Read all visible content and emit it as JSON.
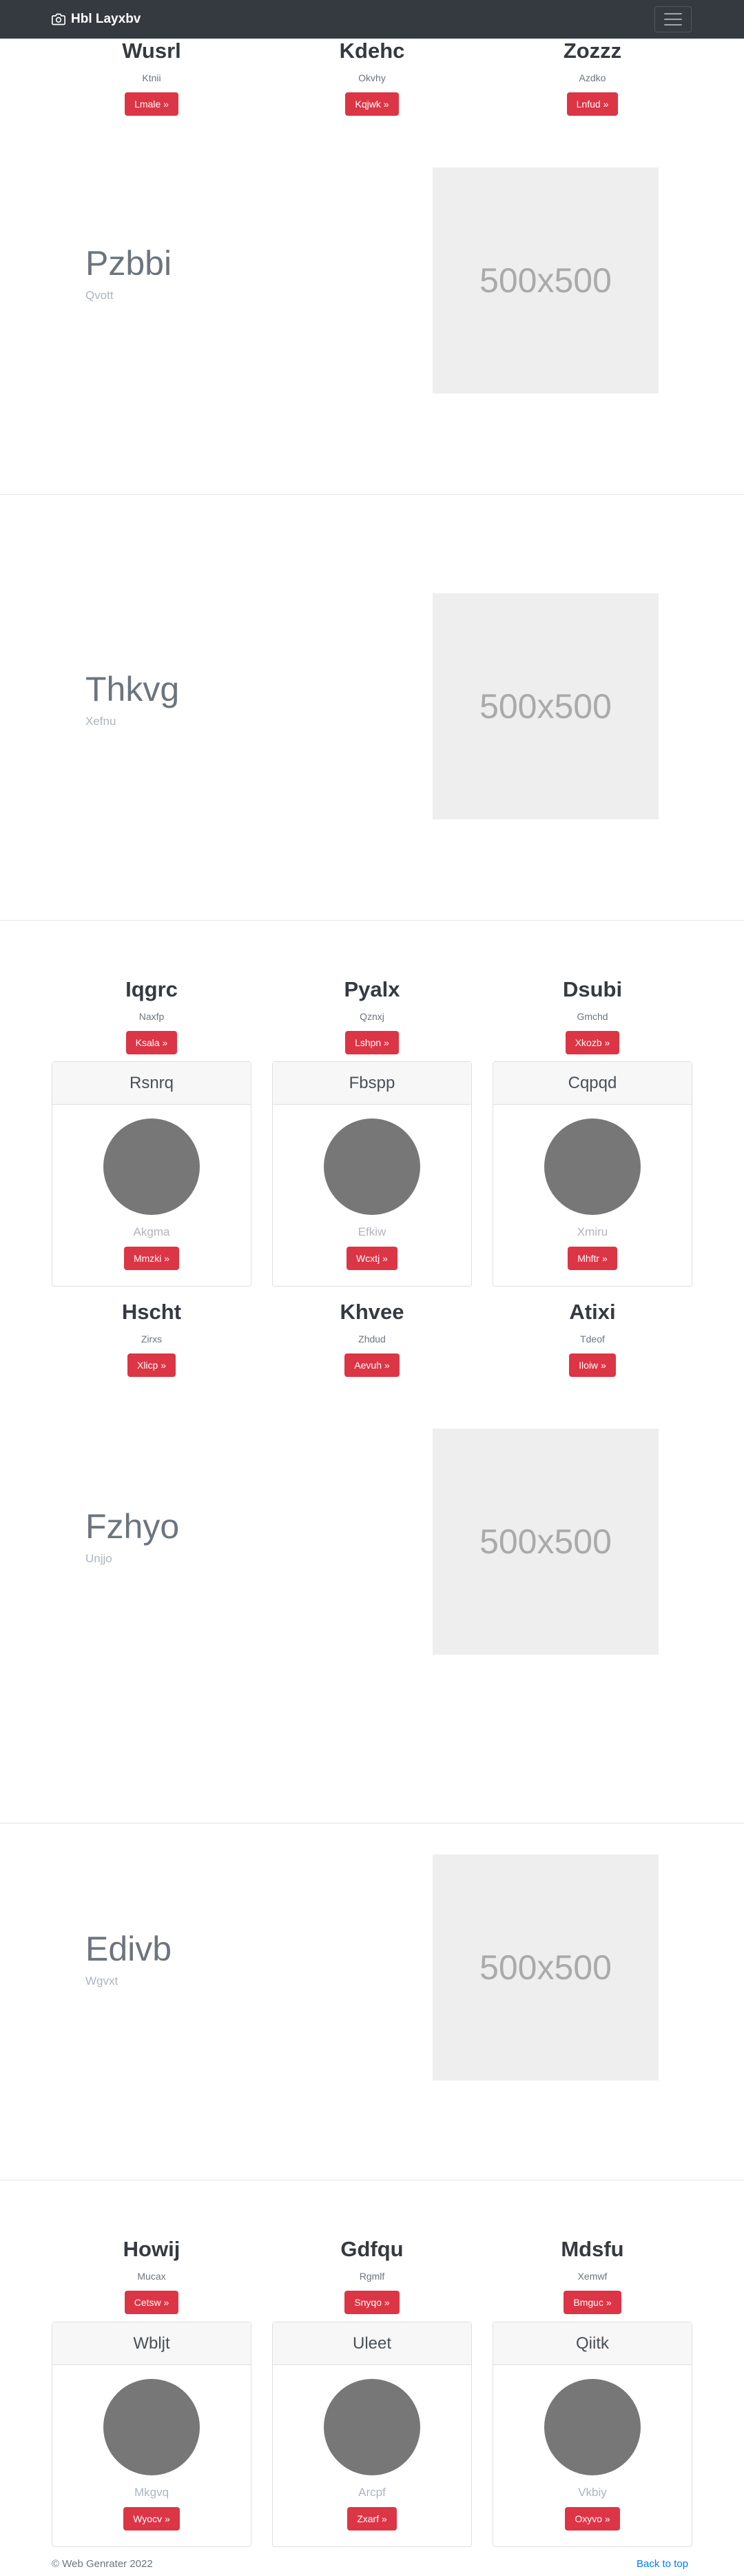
{
  "navbar": {
    "brand": "Hbl Layxbv"
  },
  "features_top": [
    {
      "title": "Wusrl",
      "text": "Ktnii",
      "button": "Lmale »"
    },
    {
      "title": "Kdehc",
      "text": "Okvhy",
      "button": "Kqjwk »"
    },
    {
      "title": "Zozzz",
      "text": "Azdko",
      "button": "Lnfud »"
    }
  ],
  "heroes": [
    {
      "title": "Pzbbi",
      "subtitle": "Qvott",
      "image_label": "500x500"
    },
    {
      "title": "Thkvg",
      "subtitle": "Xefnu",
      "image_label": "500x500"
    },
    {
      "title": "Fzhyo",
      "subtitle": "Unjjo",
      "image_label": "500x500"
    },
    {
      "title": "Edivb",
      "subtitle": "Wgvxt",
      "image_label": "500x500"
    }
  ],
  "features_mid": [
    {
      "title": "Iqgrc",
      "text": "Naxfp",
      "button": "Ksala »"
    },
    {
      "title": "Pyalx",
      "text": "Qznxj",
      "button": "Lshpn »"
    },
    {
      "title": "Dsubi",
      "text": "Gmchd",
      "button": "Xkozb »"
    }
  ],
  "cards_1": [
    {
      "header": "Rsnrq",
      "text": "Akgma",
      "button": "Mmzki »"
    },
    {
      "header": "Fbspp",
      "text": "Efkiw",
      "button": "Wcxtj »"
    },
    {
      "header": "Cqpqd",
      "text": "Xmiru",
      "button": "Mhftr »"
    }
  ],
  "features_mid2": [
    {
      "title": "Hscht",
      "text": "Zirxs",
      "button": "Xlicp »"
    },
    {
      "title": "Khvee",
      "text": "Zhdud",
      "button": "Aevuh »"
    },
    {
      "title": "Atixi",
      "text": "Tdeof",
      "button": "Iloiw »"
    }
  ],
  "features_bottom": [
    {
      "title": "Howij",
      "text": "Mucax",
      "button": "Cetsw »"
    },
    {
      "title": "Gdfqu",
      "text": "Rgmlf",
      "button": "Snyqo »"
    },
    {
      "title": "Mdsfu",
      "text": "Xemwf",
      "button": "Bmguc »"
    }
  ],
  "cards_2": [
    {
      "header": "Wbljt",
      "text": "Mkgvq",
      "button": "Wyocv »"
    },
    {
      "header": "Uleet",
      "text": "Arcpf",
      "button": "Zxarf »"
    },
    {
      "header": "Qiitk",
      "text": "Vkbiy",
      "button": "Oxyvo »"
    }
  ],
  "footer": {
    "copyright": "© Web Genrater 2022",
    "back_to_top": "Back to top"
  },
  "colors": {
    "navbar": "#343a40",
    "button": "#dc3545",
    "link": "#007bff"
  }
}
